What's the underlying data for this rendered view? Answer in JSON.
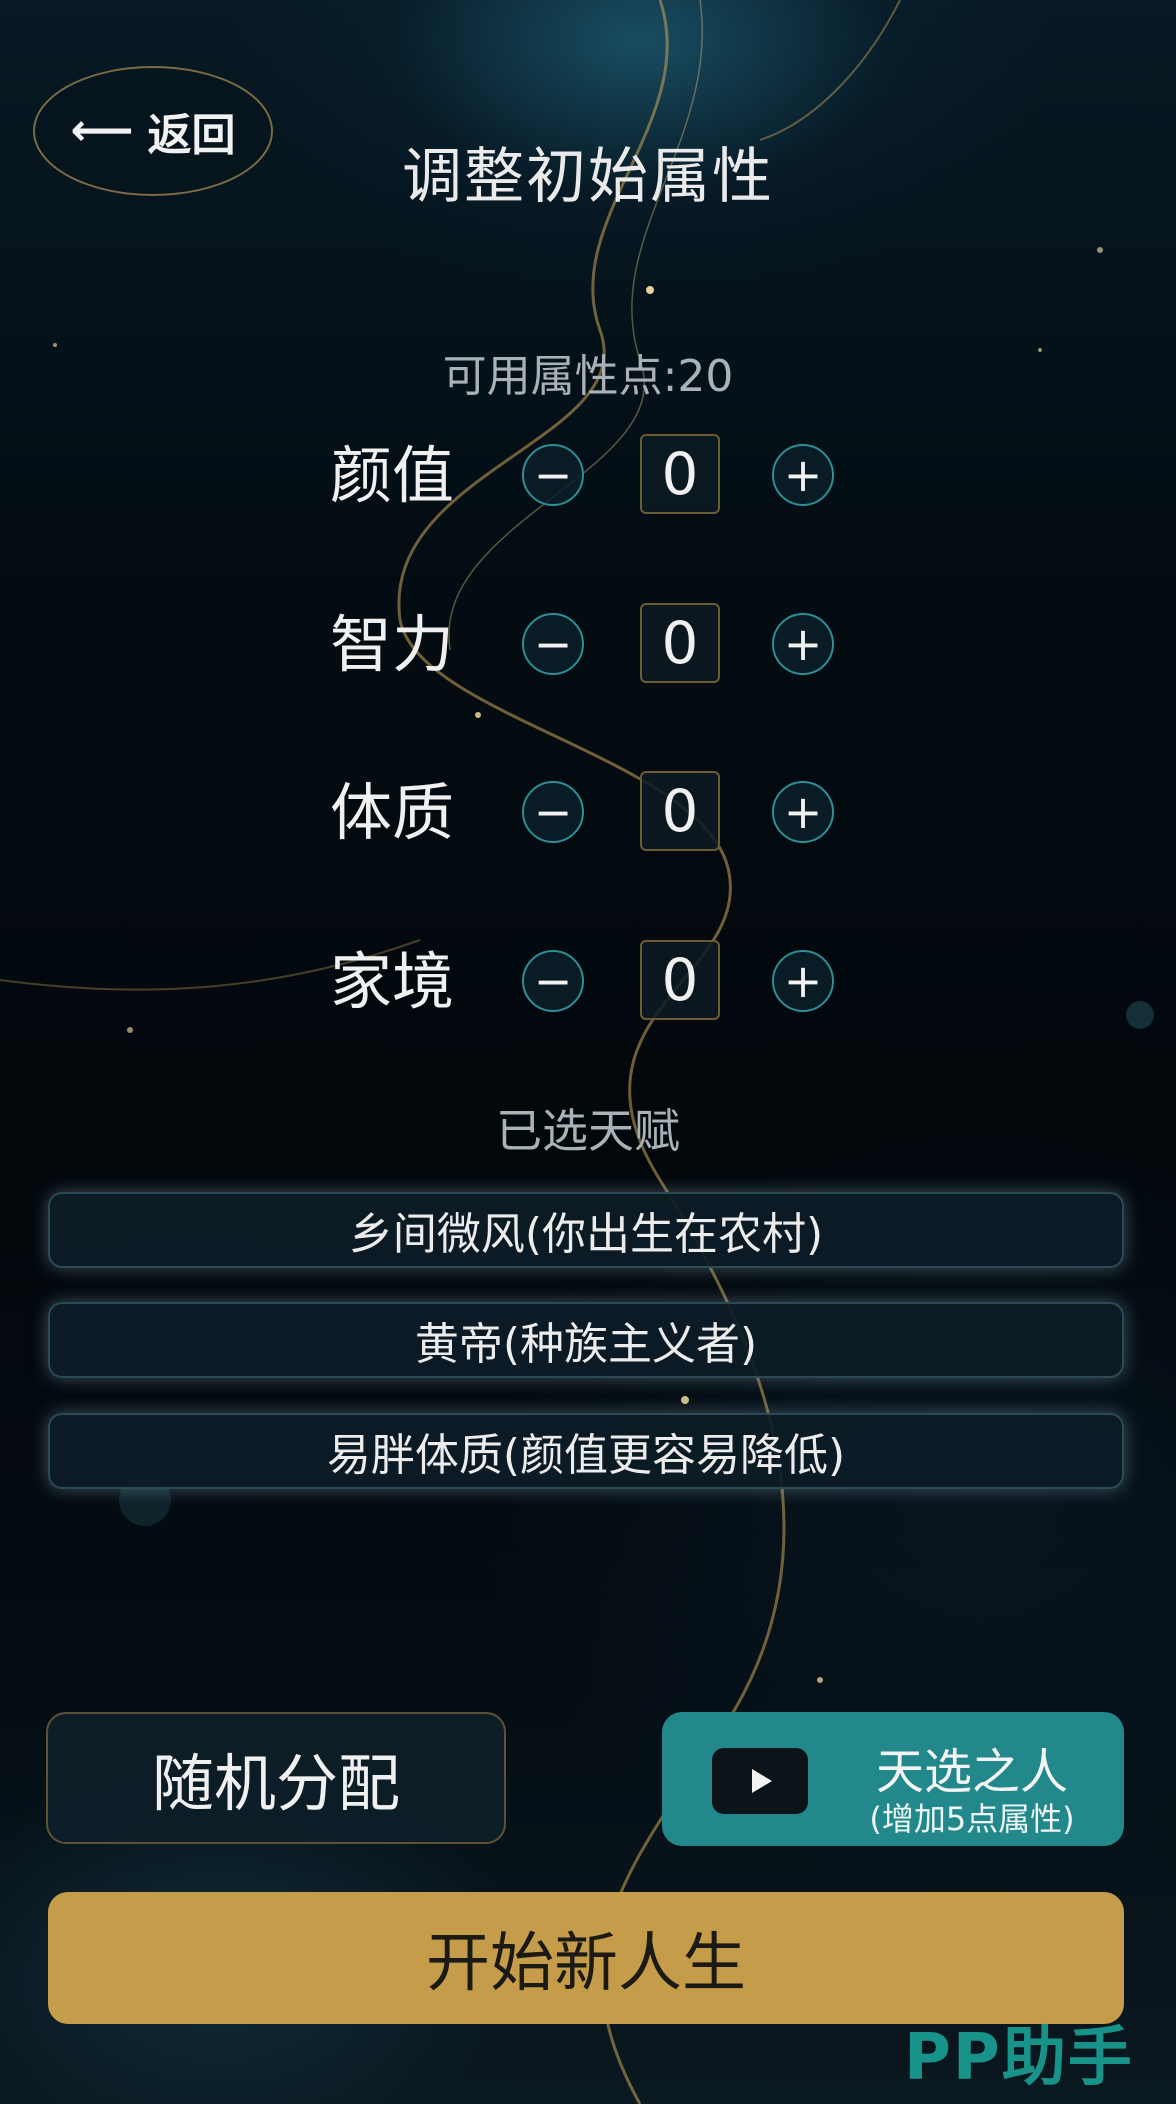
{
  "header": {
    "back_arrow": "⟵",
    "back_label": "返回",
    "title": "调整初始属性"
  },
  "points_label": "可用属性点:20",
  "attributes": [
    {
      "name": "颜值",
      "value": "0",
      "minus": "−",
      "plus": "+"
    },
    {
      "name": "智力",
      "value": "0",
      "minus": "−",
      "plus": "+"
    },
    {
      "name": "体质",
      "value": "0",
      "minus": "−",
      "plus": "+"
    },
    {
      "name": "家境",
      "value": "0",
      "minus": "−",
      "plus": "+"
    }
  ],
  "talents": {
    "title": "已选天赋",
    "items": [
      "乡间微风(你出生在农村)",
      "黄帝(种族主义者)",
      "易胖体质(颜值更容易降低)"
    ]
  },
  "actions": {
    "random_label": "随机分配",
    "chosen_label": "天选之人",
    "chosen_sub": "(增加5点属性)",
    "start_label": "开始新人生"
  },
  "watermark": "PP助手",
  "colors": {
    "accent_teal": "#22888c",
    "start_gold": "#c59c49",
    "border_gold": "#6b5c34",
    "watermark": "#1aa99c"
  }
}
